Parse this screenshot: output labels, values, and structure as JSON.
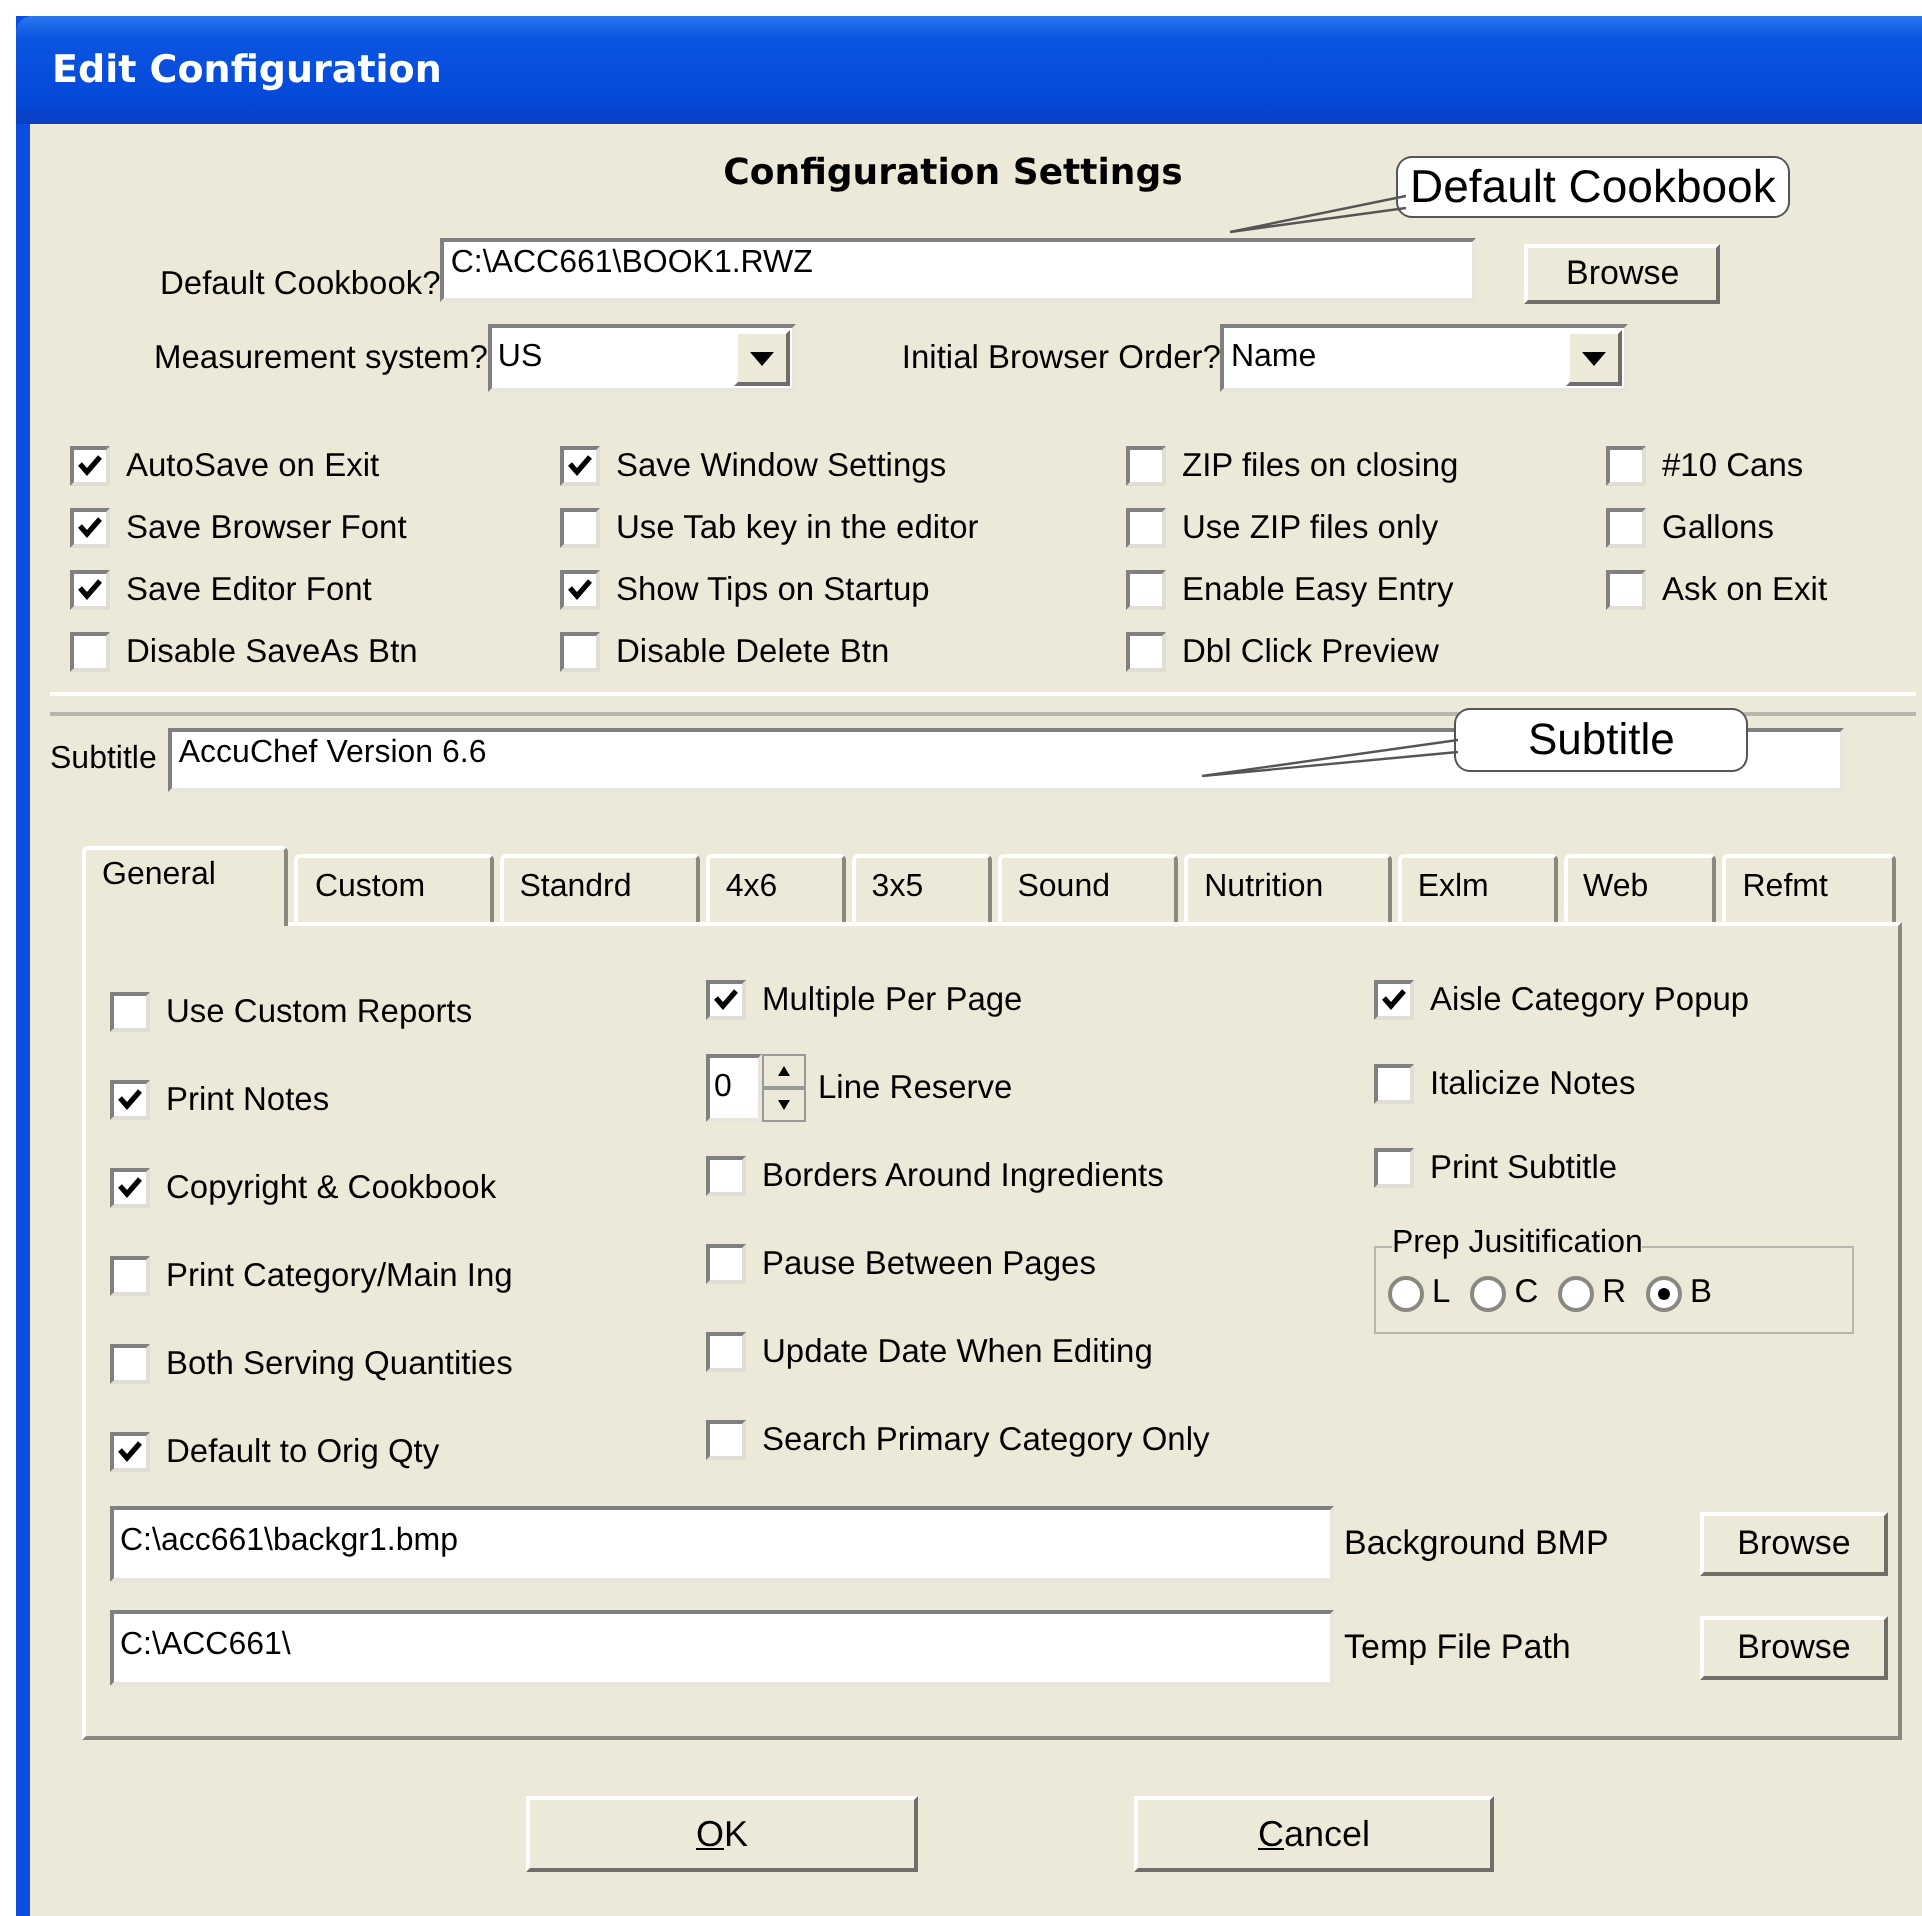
{
  "window": {
    "title": "Edit Configuration"
  },
  "heading": "Configuration Settings",
  "default_cookbook": {
    "label": "Default Cookbook?",
    "value": "C:\\ACC661\\BOOK1.RWZ",
    "button": "Browse",
    "callout": "Default Cookbook"
  },
  "measurement": {
    "label": "Measurement system?",
    "value": "US"
  },
  "browser_order": {
    "label": "Initial Browser Order?",
    "value": "Name"
  },
  "options": [
    {
      "label": "AutoSave on Exit",
      "checked": true
    },
    {
      "label": "Save Window Settings",
      "checked": true
    },
    {
      "label": "ZIP files on closing",
      "checked": false
    },
    {
      "label": "#10 Cans",
      "checked": false
    },
    {
      "label": "Save Browser Font",
      "checked": true
    },
    {
      "label": "Use Tab key in the editor",
      "checked": false
    },
    {
      "label": "Use ZIP files only",
      "checked": false
    },
    {
      "label": "Gallons",
      "checked": false
    },
    {
      "label": "Save Editor Font",
      "checked": true
    },
    {
      "label": "Show Tips on Startup",
      "checked": true
    },
    {
      "label": "Enable Easy Entry",
      "checked": false
    },
    {
      "label": "Ask on Exit",
      "checked": false
    },
    {
      "label": "Disable SaveAs Btn",
      "checked": false
    },
    {
      "label": "Disable Delete Btn",
      "checked": false
    },
    {
      "label": "Dbl Click Preview",
      "checked": false
    }
  ],
  "subtitle": {
    "label": "Subtitle",
    "value": "AccuChef Version 6.6",
    "callout": "Subtitle"
  },
  "tabs": [
    {
      "label": "General",
      "selected": true
    },
    {
      "label": "Custom",
      "selected": false
    },
    {
      "label": "Standrd",
      "selected": false
    },
    {
      "label": "4x6",
      "selected": false
    },
    {
      "label": "3x5",
      "selected": false
    },
    {
      "label": "Sound",
      "selected": false
    },
    {
      "label": "Nutrition",
      "selected": false
    },
    {
      "label": "Exlm",
      "selected": false
    },
    {
      "label": "Web",
      "selected": false
    },
    {
      "label": "Refmt",
      "selected": false
    }
  ],
  "panel_columns": [
    [
      {
        "kind": "checkbox",
        "label": "Use Custom Reports",
        "checked": false
      },
      {
        "kind": "checkbox",
        "label": "Print Notes",
        "checked": true
      },
      {
        "kind": "checkbox",
        "label": "Copyright & Cookbook",
        "checked": true
      },
      {
        "kind": "checkbox",
        "label": "Print Category/Main Ing",
        "checked": false
      },
      {
        "kind": "checkbox",
        "label": "Both Serving Quantities",
        "checked": false
      },
      {
        "kind": "checkbox",
        "label": "Default to Orig Qty",
        "checked": true
      }
    ],
    [
      {
        "kind": "checkbox",
        "label": "Multiple Per Page",
        "checked": true
      },
      {
        "kind": "spinner",
        "label": "Line Reserve",
        "value": "0"
      },
      {
        "kind": "checkbox",
        "label": "Borders Around Ingredients",
        "checked": false
      },
      {
        "kind": "checkbox",
        "label": "Pause Between Pages",
        "checked": false
      },
      {
        "kind": "checkbox",
        "label": "Update Date When Editing",
        "checked": false
      },
      {
        "kind": "checkbox",
        "label": "Search Primary Category Only",
        "checked": false
      }
    ],
    [
      {
        "kind": "checkbox",
        "label": "Aisle Category Popup",
        "checked": true
      },
      {
        "kind": "checkbox",
        "label": "Italicize Notes",
        "checked": false
      },
      {
        "kind": "checkbox",
        "label": "Print Subtitle",
        "checked": false
      },
      {
        "kind": "radio_group",
        "label": "Prep Jusitification",
        "options": [
          {
            "label": "L",
            "selected": false
          },
          {
            "label": "C",
            "selected": false
          },
          {
            "label": "R",
            "selected": false
          },
          {
            "label": "B",
            "selected": true
          }
        ]
      }
    ]
  ],
  "paths": [
    {
      "value": "C:\\acc661\\backgr1.bmp",
      "label": "Background BMP",
      "button": "Browse"
    },
    {
      "value": "C:\\ACC661\\",
      "label": "Temp File Path",
      "button": "Browse"
    }
  ],
  "buttons": [
    {
      "label": "OK"
    },
    {
      "label": "Cancel"
    }
  ]
}
